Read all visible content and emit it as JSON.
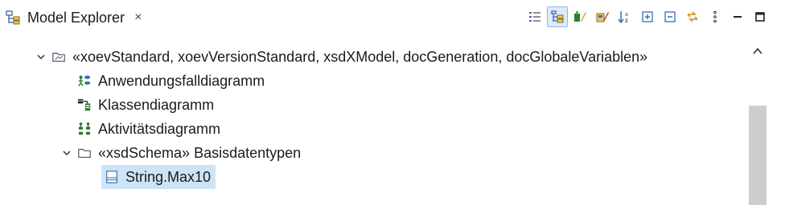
{
  "tab": {
    "title": "Model Explorer",
    "close_glyph": "×",
    "icon": "model-explorer-icon"
  },
  "toolbar": {
    "buttons": [
      {
        "name": "list-view-icon",
        "active": false
      },
      {
        "name": "tree-view-icon",
        "active": true
      },
      {
        "name": "diagram-filter-icon",
        "active": false
      },
      {
        "name": "package-filter-icon",
        "active": false
      },
      {
        "name": "sort-alphabetically-icon",
        "active": false
      },
      {
        "name": "expand-all-icon",
        "active": false
      },
      {
        "name": "collapse-all-icon",
        "active": false
      },
      {
        "name": "link-with-editor-icon",
        "active": false
      },
      {
        "name": "view-menu-icon",
        "active": false
      },
      {
        "name": "minimize-icon",
        "active": false
      },
      {
        "name": "maximize-icon",
        "active": false
      }
    ]
  },
  "tree": {
    "rows": [
      {
        "label": "«xoevStandard, xoevVersionStandard, xsdXModel, docGeneration, docGlobaleVariablen»",
        "icon": "model-package-icon",
        "expanded": true,
        "depth": 0
      },
      {
        "label": "Anwendungsfalldiagramm",
        "icon": "use-case-diagram-icon",
        "depth": 1
      },
      {
        "label": "Klassendiagramm",
        "icon": "class-diagram-icon",
        "depth": 1
      },
      {
        "label": "Aktivitätsdiagramm",
        "icon": "activity-diagram-icon",
        "depth": 1
      },
      {
        "label": "«xsdSchema» Basisdatentypen",
        "icon": "folder-icon",
        "expanded": true,
        "depth": 1
      },
      {
        "label": "String.Max10",
        "icon": "class-icon",
        "depth": 2,
        "selected": true
      }
    ]
  },
  "colors": {
    "selection": "#cce4f7",
    "toolbar_active": "#dcebfb",
    "scroll_thumb": "#cdcdcd"
  }
}
